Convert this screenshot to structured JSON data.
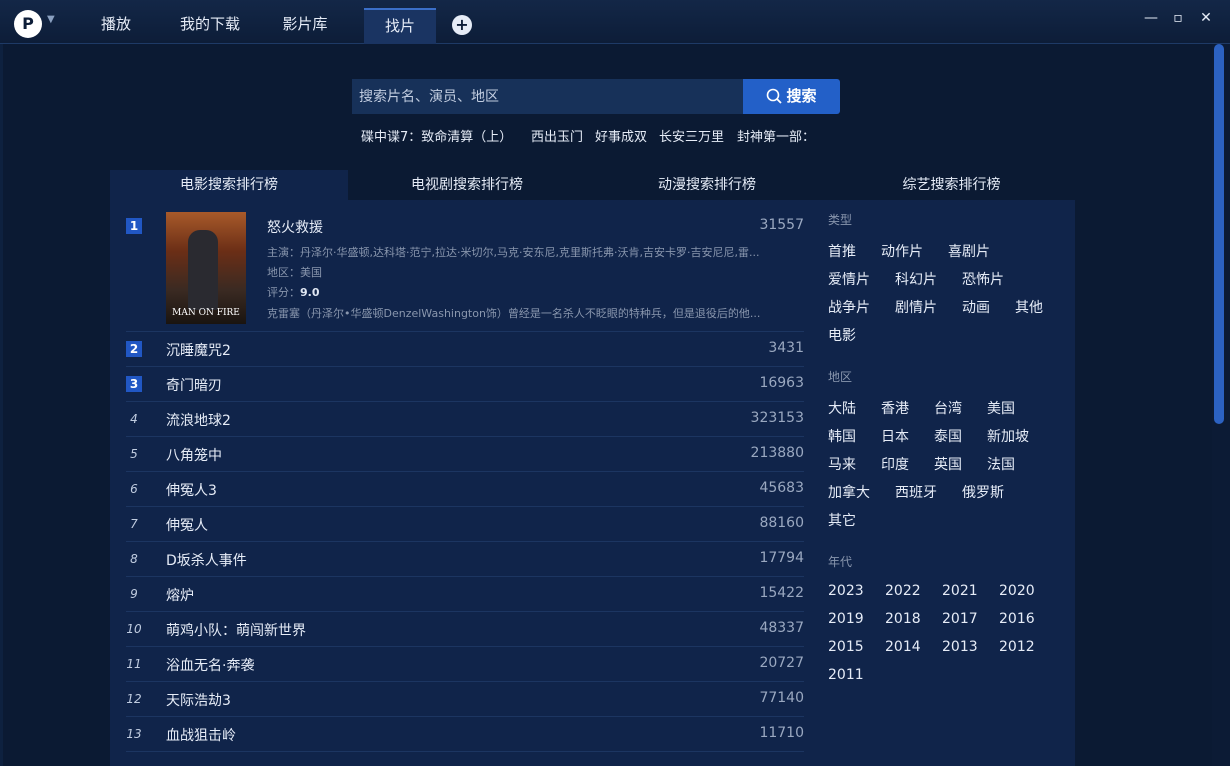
{
  "titlebar": {
    "logo_letter": "P",
    "tabs": [
      {
        "label": "播放"
      },
      {
        "label": "我的下载"
      },
      {
        "label": "影片库"
      },
      {
        "label": "找片"
      }
    ],
    "add_tab": "+",
    "controls": {
      "minimize": "—",
      "maximize": "▫",
      "close": "✕"
    }
  },
  "search": {
    "placeholder": "搜索片名、演员、地区",
    "button_label": "搜索"
  },
  "hot_searches": [
    "碟中谍7：致命清算（上）",
    "西出玉门",
    "好事成双",
    "长安三万里",
    "封神第一部："
  ],
  "ranking_tabs": [
    {
      "label": "电影搜索排行榜"
    },
    {
      "label": "电视剧搜索排行榜"
    },
    {
      "label": "动漫搜索排行榜"
    },
    {
      "label": "综艺搜索排行榜"
    }
  ],
  "featured": {
    "rank": "1",
    "title": "怒火救援",
    "count": "31557",
    "poster_text": "MAN ON FIRE",
    "cast_label": "主演：",
    "cast": "丹泽尔·华盛顿,达科塔·范宁,拉达·米切尔,马克·安东尼,克里斯托弗·沃肯,吉安卡罗·吉安尼尼,雷...",
    "region_label": "地区：",
    "region": "美国",
    "rating_label": "评分：",
    "rating": "9.0",
    "synopsis": "克雷塞（丹泽尔•华盛顿DenzelWashington饰）曾经是一名杀人不眨眼的特种兵，但是退役后的他..."
  },
  "rankings": [
    {
      "rank": "2",
      "title": "沉睡魔咒2",
      "count": "3431"
    },
    {
      "rank": "3",
      "title": "奇门暗刃",
      "count": "16963"
    },
    {
      "rank": "4",
      "title": "流浪地球2",
      "count": "323153"
    },
    {
      "rank": "5",
      "title": "八角笼中",
      "count": "213880"
    },
    {
      "rank": "6",
      "title": "伸冤人3",
      "count": "45683"
    },
    {
      "rank": "7",
      "title": "伸冤人",
      "count": "88160"
    },
    {
      "rank": "8",
      "title": "D坂杀人事件",
      "count": "17794"
    },
    {
      "rank": "9",
      "title": "熔炉",
      "count": "15422"
    },
    {
      "rank": "10",
      "title": "萌鸡小队：萌闯新世界",
      "count": "48337"
    },
    {
      "rank": "11",
      "title": "浴血无名·奔袭",
      "count": "20727"
    },
    {
      "rank": "12",
      "title": "天际浩劫3",
      "count": "77140"
    },
    {
      "rank": "13",
      "title": "血战狙击岭",
      "count": "11710"
    }
  ],
  "categories": {
    "type_title": "类型",
    "types": [
      "首推",
      "动作片",
      "喜剧片",
      "爱情片",
      "科幻片",
      "恐怖片",
      "战争片",
      "剧情片",
      "动画",
      "其他",
      "电影"
    ],
    "region_title": "地区",
    "regions": [
      "大陆",
      "香港",
      "台湾",
      "美国",
      "韩国",
      "日本",
      "泰国",
      "新加坡",
      "马来",
      "印度",
      "英国",
      "法国",
      "加拿大",
      "西班牙",
      "俄罗斯",
      "其它"
    ],
    "year_title": "年代",
    "years": [
      "2023",
      "2022",
      "2021",
      "2020",
      "2019",
      "2018",
      "2017",
      "2016",
      "2015",
      "2014",
      "2013",
      "2012",
      "2011"
    ]
  }
}
